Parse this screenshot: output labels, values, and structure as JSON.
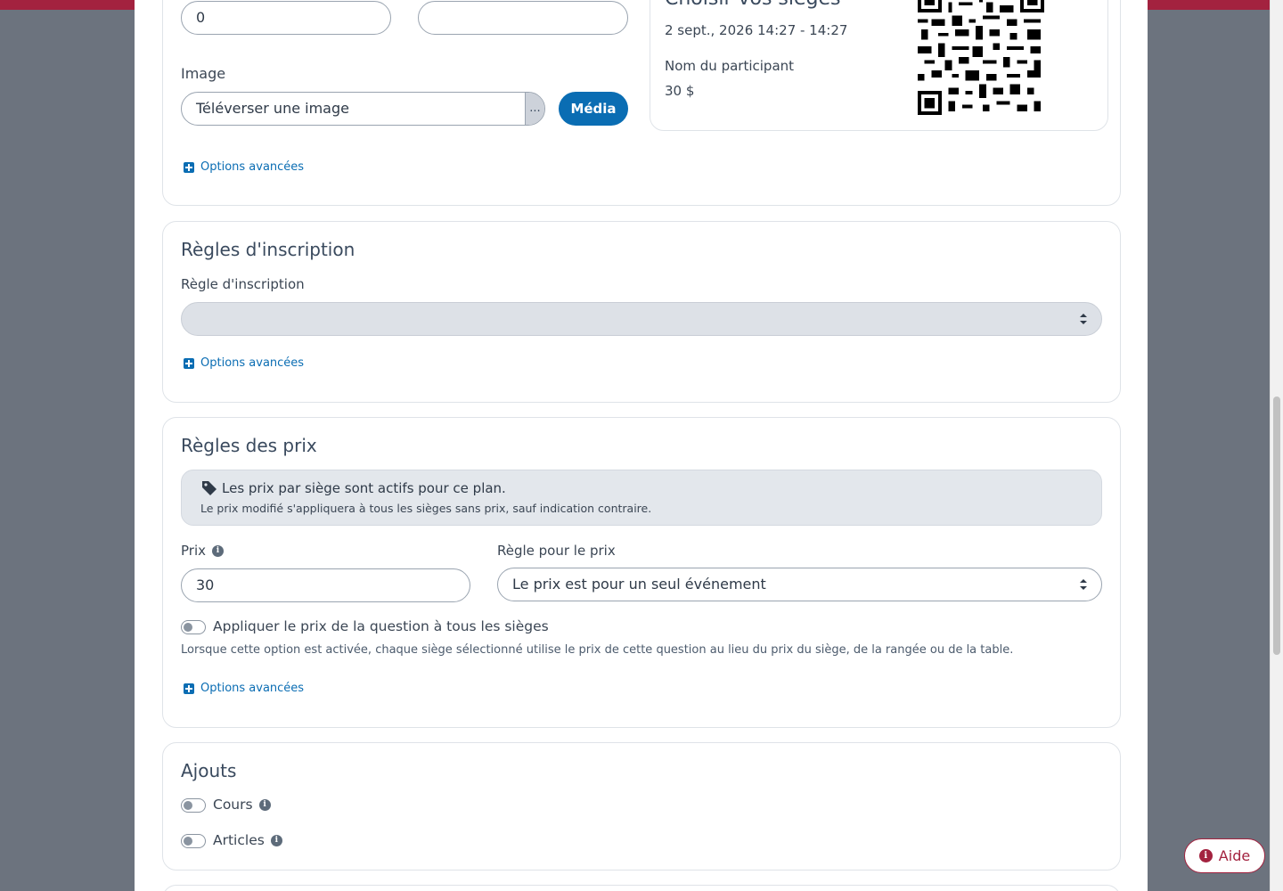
{
  "image_section": {
    "quantity_value": "0",
    "second_value": "",
    "image_label": "Image",
    "upload_value": "Téléverser une image",
    "browse_label": "...",
    "media_button": "Média",
    "advanced_options": "Options avancées"
  },
  "ticket_preview": {
    "title": "Choisir vos sièges",
    "datetime": "2 sept., 2026 14:27 - 14:27",
    "participant_label": "Nom du participant",
    "price": "30 $"
  },
  "registration": {
    "title": "Règles d'inscription",
    "rule_label": "Règle d'inscription",
    "rule_value": "",
    "advanced_options": "Options avancées"
  },
  "pricing": {
    "title": "Règles des prix",
    "notice_title": "Les prix par siège sont actifs pour ce plan.",
    "notice_body": "Le prix modifié s'appliquera à tous les sièges sans prix, sauf indication contraire.",
    "price_label": "Prix",
    "price_value": "30",
    "price_rule_label": "Règle pour le prix",
    "price_rule_value": "Le prix est pour un seul événement",
    "apply_toggle_label": "Appliquer le prix de la question à tous les sièges",
    "apply_toggle_on": false,
    "apply_help": "Lorsque cette option est activée, chaque siège sélectionné utilise le prix de cette question au lieu du prix du siège, de la rangée ou de la table.",
    "advanced_options": "Options avancées"
  },
  "addons": {
    "title": "Ajouts",
    "items": [
      {
        "label": "Cours",
        "on": false
      },
      {
        "label": "Articles",
        "on": false
      }
    ]
  },
  "help_button": "Aide",
  "colors": {
    "brand": "#a3223f",
    "accent": "#0a6db3",
    "overlay": "#6c737e"
  }
}
